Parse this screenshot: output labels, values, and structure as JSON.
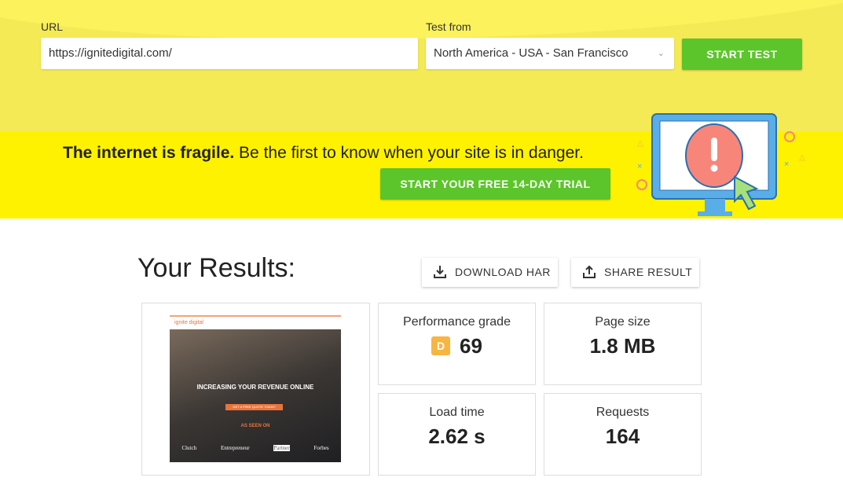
{
  "form": {
    "url_label": "URL",
    "url_value": "https://ignitedigital.com/",
    "from_label": "Test from",
    "from_value": "North America - USA - San Francisco",
    "start_label": "START TEST"
  },
  "promo": {
    "bold": "The internet is fragile.",
    "text": " Be the first to know when your site is in danger.",
    "cta": "START YOUR FREE 14-DAY TRIAL"
  },
  "results": {
    "title": "Your Results:",
    "download": "DOWNLOAD HAR",
    "share": "SHARE RESULT",
    "thumb": {
      "brand": "ignite digital",
      "headline": "INCREASING YOUR REVENUE ONLINE",
      "cta": "GET A FREE QUOTE TODAY!",
      "seen": "AS SEEN ON",
      "logos": [
        "Clutch",
        "Entrepreneur",
        "Partner",
        "Forbes"
      ]
    },
    "metrics": [
      {
        "label": "Performance grade",
        "grade": "D",
        "value": "69"
      },
      {
        "label": "Page size",
        "value": "1.8 MB"
      },
      {
        "label": "Load time",
        "value": "2.62 s"
      },
      {
        "label": "Requests",
        "value": "164"
      }
    ]
  },
  "colors": {
    "green": "#5cc52b",
    "yellow": "#fff200",
    "grade": "#f7b541"
  }
}
